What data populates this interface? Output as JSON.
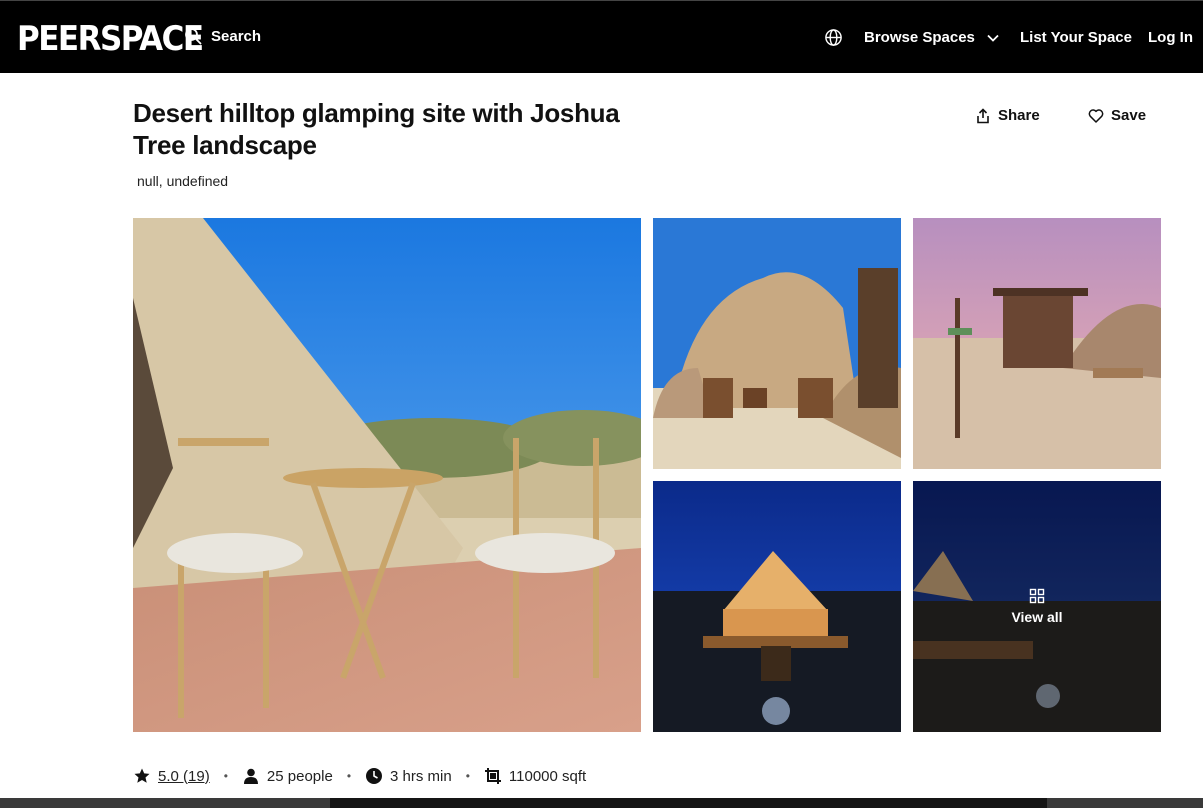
{
  "header": {
    "logo": "PEERSPACE",
    "search_label": "Search",
    "browse_label": "Browse Spaces",
    "list_label": "List Your Space",
    "login_label": "Log In"
  },
  "listing": {
    "title": "Desert hilltop glamping site with Joshua Tree landscape",
    "location": "null, undefined",
    "share_label": "Share",
    "save_label": "Save"
  },
  "gallery": {
    "view_all_label": "View all"
  },
  "stats": {
    "rating": "5.0 (19)",
    "capacity": "25 people",
    "min_hours": "3 hrs min",
    "size": "110000 sqft"
  },
  "colors": {
    "header_bg": "#000000",
    "text": "#111111",
    "sky": "#1e7fe6"
  },
  "icons": [
    "search-icon",
    "globe-icon",
    "chevron-down-icon",
    "share-icon",
    "heart-icon",
    "grid-icon",
    "star-icon",
    "person-icon",
    "clock-icon",
    "crop-icon"
  ]
}
